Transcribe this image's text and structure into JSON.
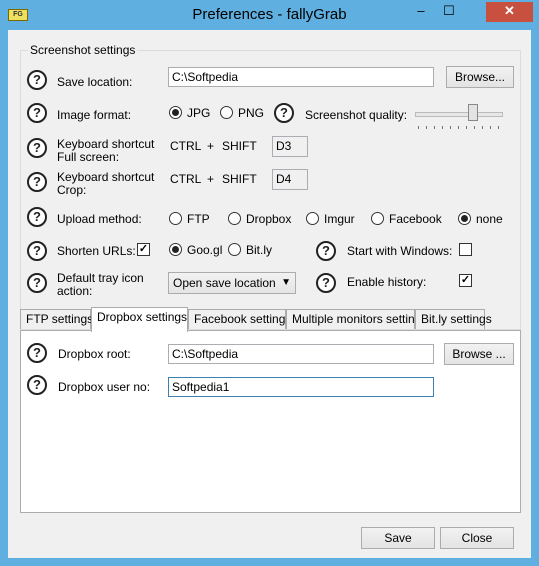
{
  "window": {
    "title": "Preferences - fallyGrab",
    "app_icon_text": "FG"
  },
  "titlebar": {
    "minimize": "–",
    "maximize": "☐",
    "close": "✕"
  },
  "help_icon": "?",
  "screenshot_settings": {
    "group_title": "Screenshot settings",
    "save_location_label": "Save location:",
    "save_location_value": "C:\\Softpedia",
    "browse_label": "Browse...",
    "image_format_label": "Image format:",
    "formats": [
      {
        "label": "JPG",
        "selected": true
      },
      {
        "label": "PNG",
        "selected": false
      }
    ],
    "quality_label": "Screenshot quality:",
    "quality_value": 0.7,
    "kb_full_label_1": "Keyboard shortcut",
    "kb_full_label_2": "Full screen:",
    "kb_crop_label_1": "Keyboard shortcut",
    "kb_crop_label_2": "Crop:",
    "ctrl": "CTRL",
    "plus": "+",
    "shift": "SHIFT",
    "kb_full_key": "D3",
    "kb_crop_key": "D4",
    "upload_method_label": "Upload method:",
    "upload_methods": [
      {
        "label": "FTP",
        "selected": false
      },
      {
        "label": "Dropbox",
        "selected": false
      },
      {
        "label": "Imgur",
        "selected": false
      },
      {
        "label": "Facebook",
        "selected": false
      },
      {
        "label": "none",
        "selected": true
      }
    ],
    "shorten_urls_label": "Shorten URLs:",
    "shorten_urls_checked": true,
    "shorteners": [
      {
        "label": "Goo.gl",
        "selected": true
      },
      {
        "label": "Bit.ly",
        "selected": false
      }
    ],
    "start_with_windows_label": "Start with Windows:",
    "start_with_windows_checked": false,
    "tray_label_1": "Default tray icon",
    "tray_label_2": "action:",
    "tray_value": "Open save location",
    "enable_history_label": "Enable history:",
    "enable_history_checked": true
  },
  "tabs": [
    {
      "label": "FTP settings",
      "active": false
    },
    {
      "label": "Dropbox settings",
      "active": true
    },
    {
      "label": "Facebook settings",
      "active": false
    },
    {
      "label": "Multiple monitors settings",
      "active": false
    },
    {
      "label": "Bit.ly settings",
      "active": false
    }
  ],
  "dropbox": {
    "root_label": "Dropbox root:",
    "root_value": "C:\\Softpedia",
    "browse_label": "Browse ...",
    "user_no_label": "Dropbox user no:",
    "user_no_value": "Softpedia1"
  },
  "footer": {
    "save_label": "Save",
    "close_label": "Close"
  }
}
